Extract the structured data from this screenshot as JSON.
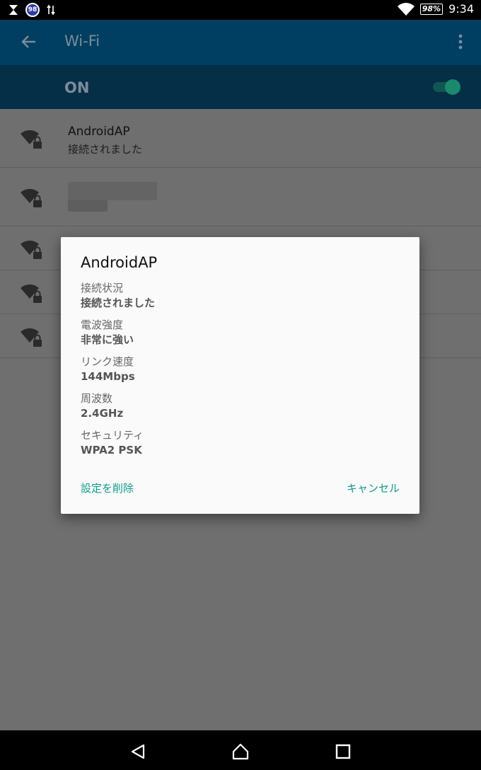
{
  "status_bar": {
    "notification_count": "98",
    "battery": "98%",
    "time": "9:34"
  },
  "app_bar": {
    "title": "Wi-Fi"
  },
  "wifi_switch": {
    "label": "ON",
    "state": "on",
    "accent_color": "#1a8a6d"
  },
  "networks": [
    {
      "name": "AndroidAP",
      "status": "接続されました"
    },
    {
      "name": "",
      "status": ""
    },
    {
      "name": "",
      "status": ""
    },
    {
      "name": "",
      "status": ""
    },
    {
      "name": "",
      "status": ""
    }
  ],
  "dialog": {
    "title": "AndroidAP",
    "fields": [
      {
        "label": "接続状況",
        "value": "接続されました"
      },
      {
        "label": "電波強度",
        "value": "非常に強い"
      },
      {
        "label": "リンク速度",
        "value": "144Mbps"
      },
      {
        "label": "周波数",
        "value": "2.4GHz"
      },
      {
        "label": "セキュリティ",
        "value": "WPA2 PSK"
      }
    ],
    "forget_label": "設定を削除",
    "cancel_label": "キャンセル",
    "action_color": "#0f9d8a"
  },
  "icons": {
    "back": "arrow-back-icon",
    "more": "more-vert-icon",
    "wifi": "wifi-lock-icon",
    "nav_back": "nav-back-icon",
    "nav_home": "nav-home-icon",
    "nav_recents": "nav-recents-icon"
  }
}
